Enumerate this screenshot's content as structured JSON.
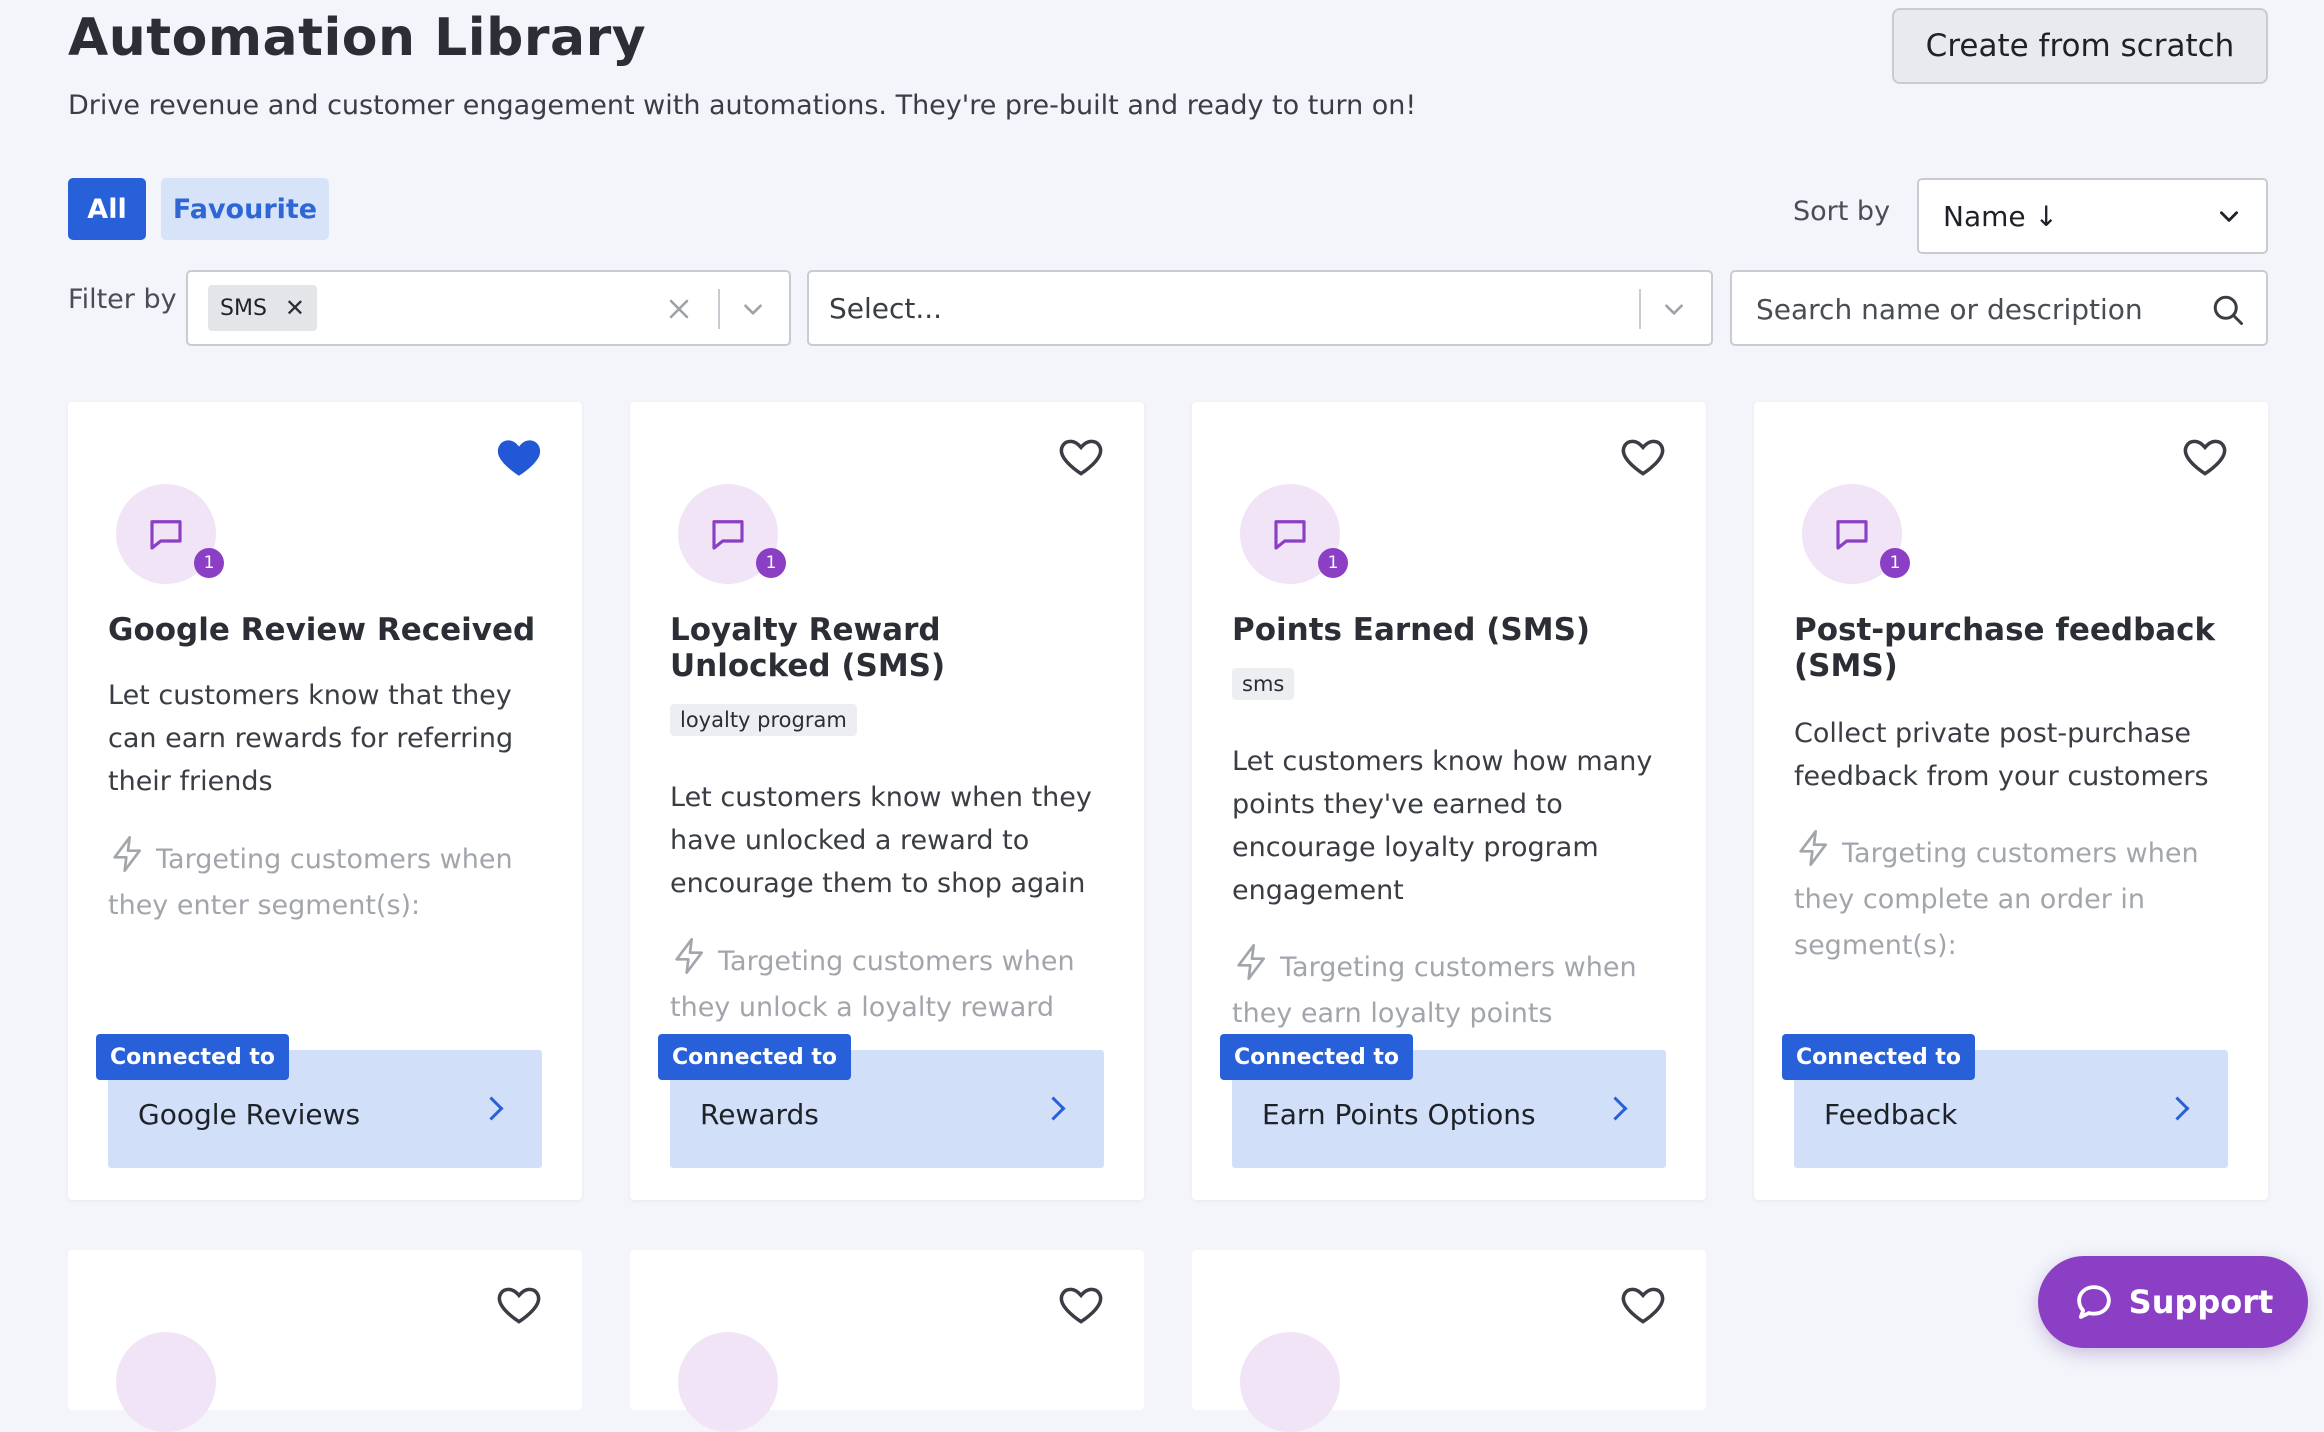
{
  "header": {
    "title": "Automation Library",
    "subtitle": "Drive revenue and customer engagement with automations. They're pre-built and ready to turn on!",
    "create_label": "Create from scratch"
  },
  "tabs": {
    "all": "All",
    "favourite": "Favourite"
  },
  "sort": {
    "label": "Sort by",
    "value": "Name ↓"
  },
  "filter": {
    "label": "Filter by",
    "chip": "SMS",
    "select_placeholder": "Select...",
    "search_placeholder": "Search name or description"
  },
  "cards": [
    {
      "title": "Google Review Received",
      "tag": "",
      "badge": "1",
      "favourite": true,
      "description": "Let customers know that they can earn rewards for referring their friends",
      "targeting": "Targeting customers when they enter segment(s):",
      "connected_label": "Connected to",
      "connected": "Google Reviews"
    },
    {
      "title": "Loyalty Reward Unlocked (SMS)",
      "tag": "loyalty program",
      "badge": "1",
      "favourite": false,
      "description": "Let customers know when they have unlocked a reward to encourage them to shop again",
      "targeting": "Targeting customers when they unlock a loyalty reward",
      "connected_label": "Connected to",
      "connected": "Rewards"
    },
    {
      "title": "Points Earned (SMS)",
      "tag": "sms",
      "badge": "1",
      "favourite": false,
      "description": "Let customers know how many points they've earned to encourage loyalty program engagement",
      "targeting": "Targeting customers when they earn loyalty points",
      "connected_label": "Connected to",
      "connected": "Earn Points Options"
    },
    {
      "title": "Post-purchase feedback (SMS)",
      "tag": "",
      "badge": "1",
      "favourite": false,
      "description": "Collect private post-purchase feedback from your customers",
      "targeting": "Targeting customers when they complete an order in segment(s):",
      "connected_label": "Connected to",
      "connected": "Feedback"
    }
  ],
  "support": {
    "label": "Support"
  },
  "colors": {
    "accent": "#2760d9",
    "purple": "#8a3fc4",
    "connected_bg": "#d1e0f8"
  }
}
